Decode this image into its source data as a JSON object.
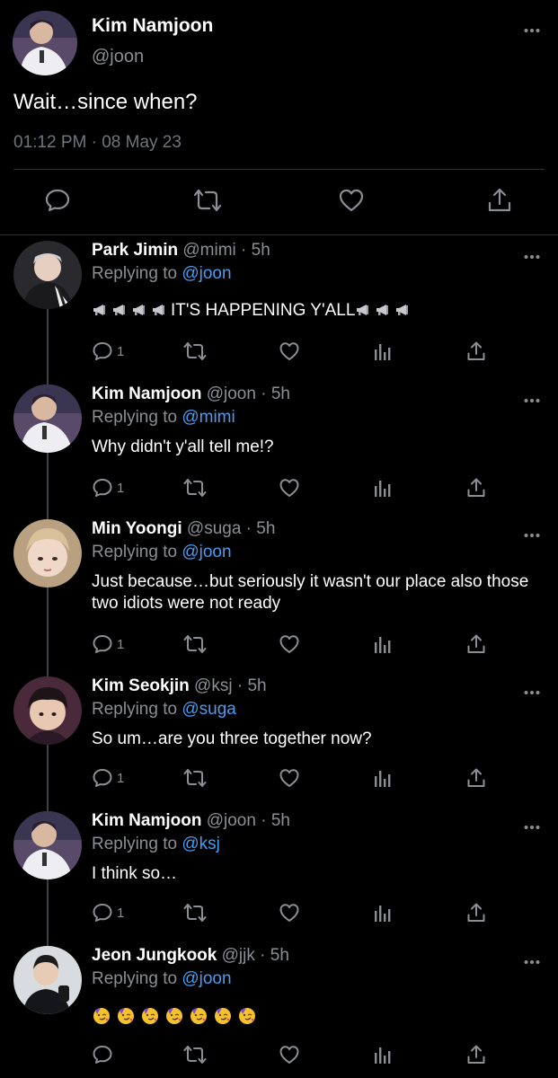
{
  "main_tweet": {
    "name": "Kim Namjoon",
    "handle": "@joon",
    "text": "Wait…since when?",
    "timestamp": "01:12 PM · 08 May 23",
    "actions": [
      "reply-icon",
      "retweet-icon",
      "like-icon",
      "share-icon"
    ]
  },
  "replies": [
    {
      "name": "Park Jimin",
      "handle": "@mimi",
      "time": "5h",
      "replying_prefix": "Replying to ",
      "replying_to": "@joon",
      "text_before": "",
      "text": "IT'S HAPPENING Y'ALL",
      "reply_count": "1",
      "emoji_icon": "megaphone-icon"
    },
    {
      "name": "Kim Namjoon",
      "handle": "@joon",
      "time": "5h",
      "replying_prefix": "Replying to ",
      "replying_to": "@mimi",
      "text": "Why didn't y'all tell me!?",
      "reply_count": "1"
    },
    {
      "name": "Min Yoongi",
      "handle": "@suga",
      "time": "5h",
      "replying_prefix": "Replying to ",
      "replying_to": "@joon",
      "text": "Just because…but seriously it wasn't our place also those two idiots were not ready",
      "reply_count": "1"
    },
    {
      "name": "Kim Seokjin",
      "handle": "@ksj",
      "time": "5h",
      "replying_prefix": "Replying to ",
      "replying_to": "@suga",
      "text": "So um…are you three together now?",
      "reply_count": "1"
    },
    {
      "name": "Kim Namjoon",
      "handle": "@joon",
      "time": "5h",
      "replying_prefix": "Replying to ",
      "replying_to": "@ksj",
      "text": "I think so…",
      "reply_count": "1"
    },
    {
      "name": "Jeon Jungkook",
      "handle": "@jjk",
      "time": "5h",
      "replying_prefix": "Replying to ",
      "replying_to": "@joon",
      "text": "",
      "emoji_icon": "partying-face-icon",
      "reply_count": ""
    }
  ],
  "separator": " · ",
  "colors": {
    "background": "#000000",
    "text": "#ffffff",
    "muted": "#8b8f94",
    "mention": "#4a9cf0",
    "divider": "#2f3336"
  }
}
